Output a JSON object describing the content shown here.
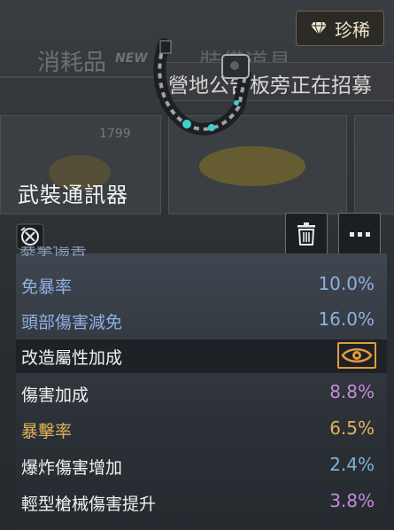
{
  "background": {
    "tabs": [
      "消耗品",
      "裝備道具"
    ],
    "new_badge": "NEW",
    "price": "1799"
  },
  "rarity": {
    "label": "珍稀",
    "icon": "diamond-icon",
    "color": "#f0e6cf"
  },
  "banner": {
    "text": "營地公告板旁正在招募"
  },
  "item": {
    "name": "武裝通訊器"
  },
  "buttons": {
    "delete": "trash-icon",
    "more": "more-dots-icon"
  },
  "stats": {
    "cut_off_label": "暴擊傷害",
    "rows": [
      {
        "label": "免暴率",
        "value": "10.0%",
        "label_color": "#8fb0e0",
        "value_color": "#8fb0e0"
      },
      {
        "label": "頭部傷害減免",
        "value": "16.0%",
        "label_color": "#8fb0e0",
        "value_color": "#8fb0e0"
      },
      {
        "label": "改造屬性加成",
        "value": "",
        "label_color": "#f0f0f0",
        "value_color": "#e59a3b"
      },
      {
        "label": "傷害加成",
        "value": "8.8%",
        "label_color": "#f0f0f0",
        "value_color": "#c48ad8"
      },
      {
        "label": "暴擊率",
        "value": "6.5%",
        "label_color": "#e0b45a",
        "value_color": "#e0b45a"
      },
      {
        "label": "爆炸傷害增加",
        "value": "2.4%",
        "label_color": "#f0f0f0",
        "value_color": "#7fb4d6"
      },
      {
        "label": "輕型槍械傷害提升",
        "value": "3.8%",
        "label_color": "#f0f0f0",
        "value_color": "#c48ad8"
      }
    ]
  }
}
